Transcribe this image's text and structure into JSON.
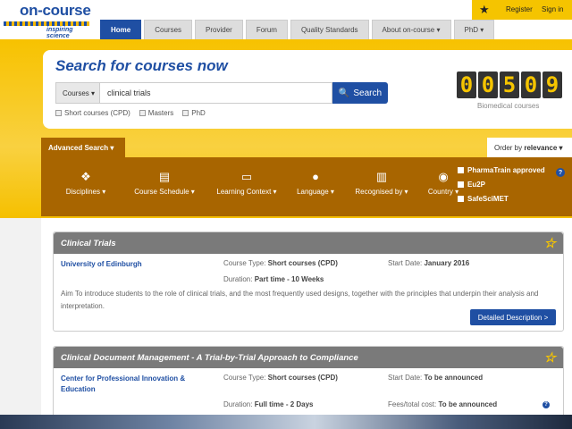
{
  "logo": {
    "title": "on-course",
    "tagline": "inspiring science"
  },
  "nav": {
    "tabs": [
      {
        "label": "Home"
      },
      {
        "label": "Courses"
      },
      {
        "label": "Provider"
      },
      {
        "label": "Forum"
      },
      {
        "label": "Quality Standards"
      },
      {
        "label": "About on-course ▾"
      },
      {
        "label": "PhD ▾"
      }
    ]
  },
  "account": {
    "register": "Register",
    "signin": "Sign in"
  },
  "search": {
    "title": "Search for courses now",
    "select_value": "Courses ▾",
    "query": "clinical trials",
    "button_label": "Search",
    "checkboxes": [
      "Short courses (CPD)",
      "Masters",
      "PhD"
    ]
  },
  "counter": {
    "digits": [
      "0",
      "0",
      "5",
      "0",
      "9"
    ],
    "label": "Biomedical courses"
  },
  "advanced": {
    "tab_label": "Advanced Search ▾",
    "order_label": "Order by",
    "order_value": "relevance ▾",
    "filters": [
      {
        "label": "Disciplines ▾",
        "icon": "tags-icon"
      },
      {
        "label": "Course Schedule ▾",
        "icon": "book-icon"
      },
      {
        "label": "Learning Context ▾",
        "icon": "monitor-icon"
      },
      {
        "label": "Language ▾",
        "icon": "speech-bubble-icon"
      },
      {
        "label": "Recognised by ▾",
        "icon": "building-icon"
      },
      {
        "label": "Country ▾",
        "icon": "globe-icon"
      }
    ],
    "side_checks": [
      "PharmaTrain approved",
      "Eu2P",
      "SafeSciMET"
    ]
  },
  "results": [
    {
      "title": "Clinical Trials",
      "institution": "University of Edinburgh",
      "type_label": "Course Type:",
      "type_value": "Short courses (CPD)",
      "duration_label": "Duration:",
      "duration_value": "Part time - 10 Weeks",
      "start_label": "Start Date:",
      "start_value": "January 2016",
      "description": "Aim To introduce students to the role of clinical trials, and the most frequently used designs, together with the principles that underpin their analysis and interpretation.",
      "button": "Detailed Description >"
    },
    {
      "title": "Clinical Document Management - A Trial-by-Trial Approach to Compliance",
      "institution": "Center for Professional Innovation & Education",
      "type_label": "Course Type:",
      "type_value": "Short courses (CPD)",
      "duration_label": "Duration:",
      "duration_value": "Full time - 2 Days",
      "start_label": "Start Date:",
      "start_value": "To be announced",
      "fees_label": "Fees/total cost:",
      "fees_value": "To be announced"
    }
  ]
}
